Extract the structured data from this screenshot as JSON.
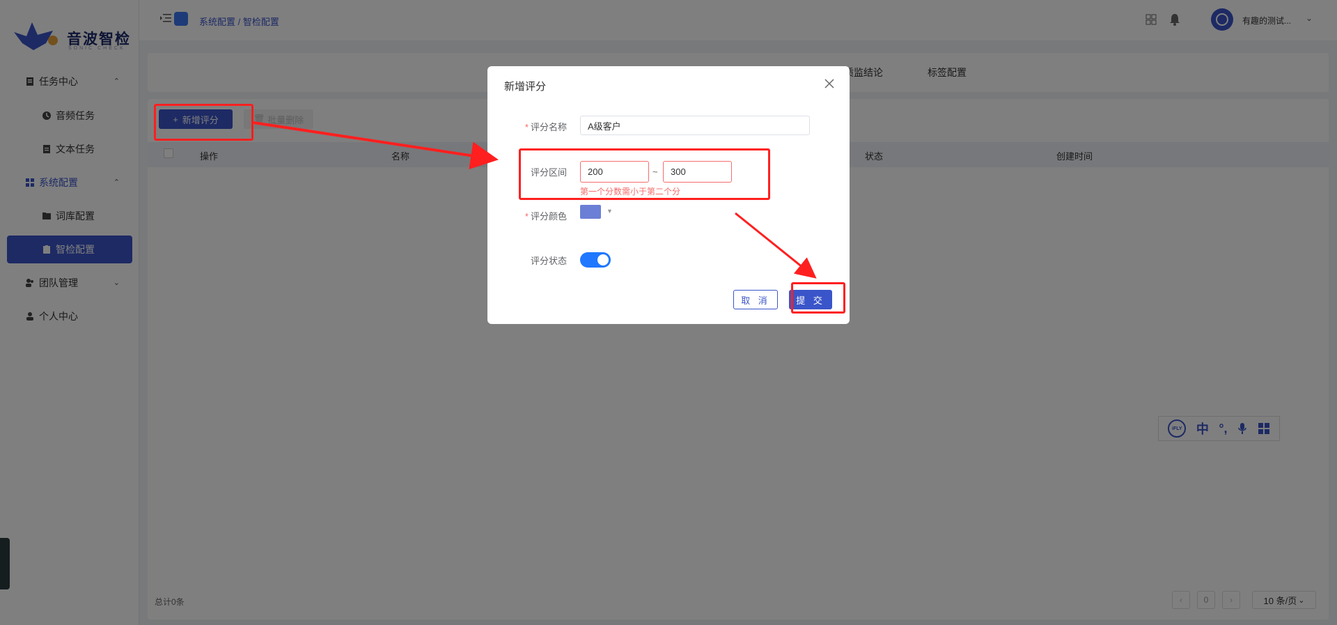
{
  "app": {
    "logo_text": "音波智检",
    "logo_sub": "SONIC CHECK"
  },
  "sidebar": {
    "items": [
      {
        "label": "任务中心",
        "icon": "document-icon"
      },
      {
        "label": "音频任务",
        "icon": "audio-icon"
      },
      {
        "label": "文本任务",
        "icon": "file-icon"
      },
      {
        "label": "系统配置",
        "icon": "dashboard-icon"
      },
      {
        "label": "词库配置",
        "icon": "folder-icon"
      },
      {
        "label": "智检配置",
        "icon": "clipboard-icon"
      },
      {
        "label": "团队管理",
        "icon": "team-icon"
      },
      {
        "label": "个人中心",
        "icon": "user-icon"
      }
    ]
  },
  "header": {
    "breadcrumb": "系统配置 / 智检配置",
    "user_name": "有趣的测试..."
  },
  "tabs": [
    "质监结论",
    "标签配置"
  ],
  "toolbar": {
    "add_label": "新增评分",
    "batch_delete_label": "批量删除"
  },
  "table": {
    "columns": [
      "操作",
      "名称",
      "状态",
      "创建时间"
    ]
  },
  "footer": {
    "total": "总计0条",
    "page_number": "0",
    "page_size": "10 条/页"
  },
  "dialog": {
    "title": "新增评分",
    "name_label": "评分名称",
    "name_value": "A级客户",
    "range_label": "评分区间",
    "range_min": "200",
    "range_sep": "~",
    "range_max": "300",
    "range_error": "第一个分数需小于第二个分",
    "color_label": "评分颜色",
    "color_value": "#6b7fd6",
    "status_label": "评分状态",
    "status_on": true,
    "cancel_label": "取 消",
    "submit_label": "提 交"
  },
  "ime_toolbar": {
    "logo": "iFLY",
    "lang": "中",
    "punct": "°,"
  },
  "colors": {
    "primary": "#3a55c9",
    "annotation": "#ff1f1f",
    "error": "#f56c6c",
    "switch_on": "#1f78ff"
  }
}
